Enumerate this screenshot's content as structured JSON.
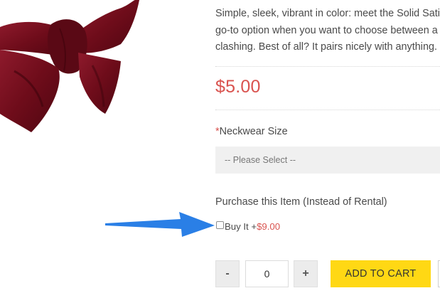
{
  "product": {
    "image_alt": "burgundy bow tie",
    "description_lines": [
      "Simple, sleek, vibrant in color: meet the Solid Sati",
      "go-to option when you want to choose between a",
      "clashing. Best of all? It pairs nicely with anything."
    ],
    "price": "$5.00"
  },
  "options": {
    "neckwear_label": "Neckwear Size",
    "required_mark": "*",
    "select_value": "-- Please Select --"
  },
  "purchase": {
    "heading": "Purchase this Item (Instead of Rental)",
    "checkbox_label": "Buy It +",
    "checkbox_price": "$9.00",
    "checked": false
  },
  "cart": {
    "minus_label": "-",
    "quantity": "0",
    "plus_label": "+",
    "add_to_cart_label": "ADD TO CART"
  },
  "colors": {
    "accent_price": "#d9534f",
    "cart_button": "#ffd814",
    "arrow": "#2a7fe6",
    "bowtie": "#7a0f1e"
  }
}
